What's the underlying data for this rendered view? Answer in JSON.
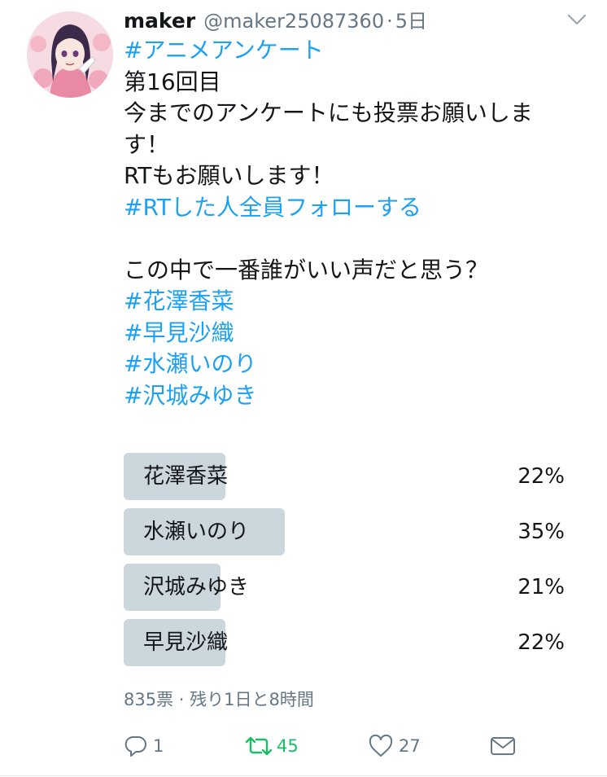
{
  "tweet": {
    "author_name": "maker",
    "handle": "@maker25087360",
    "separator": "·",
    "time": "5日",
    "body_lines": [
      {
        "text": "#アニメアンケート",
        "hashtag": true
      },
      {
        "text": "第16回目",
        "hashtag": false
      },
      {
        "text": "今までのアンケートにも投票お願いしま",
        "hashtag": false
      },
      {
        "text": "す！",
        "hashtag": false
      },
      {
        "text": "RTもお願いします！",
        "hashtag": false
      },
      {
        "text": "#RTした人全員フォローする",
        "hashtag": true
      },
      {
        "text": "",
        "hashtag": false
      },
      {
        "text": "この中で一番誰がいい声だと思う？",
        "hashtag": false
      },
      {
        "text": "#花澤香菜",
        "hashtag": true
      },
      {
        "text": "#早見沙織",
        "hashtag": true
      },
      {
        "text": "#水瀬いのり",
        "hashtag": true
      },
      {
        "text": "#沢城みゆき",
        "hashtag": true
      }
    ]
  },
  "poll": {
    "options": [
      {
        "label": "花澤香菜",
        "percent_label": "22%",
        "fraction": 0.22
      },
      {
        "label": "水瀬いのり",
        "percent_label": "35%",
        "fraction": 0.35
      },
      {
        "label": "沢城みゆき",
        "percent_label": "21%",
        "fraction": 0.21
      },
      {
        "label": "早見沙織",
        "percent_label": "22%",
        "fraction": 0.22
      }
    ],
    "meta": "835票 · 残り1日と8時間"
  },
  "actions": {
    "reply_count": "1",
    "retweet_count": "45",
    "like_count": "27"
  },
  "colors": {
    "hashtag": "#1da1f2",
    "retweet_active": "#17bf63",
    "bar": "#ccd6dd",
    "secondary_text": "#657786"
  },
  "icons": [
    "chevron-down-icon",
    "reply-icon",
    "retweet-icon",
    "like-icon",
    "message-icon"
  ]
}
